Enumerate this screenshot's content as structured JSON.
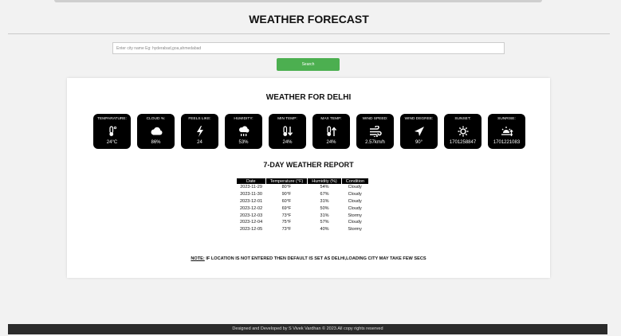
{
  "header": {
    "title": "WEATHER FORECAST"
  },
  "search": {
    "placeholder": "Enter city name Eg: hyderabad,goa,ahmedabad",
    "button_label": "Search"
  },
  "weather": {
    "title": "WEATHER FOR DELHI",
    "metrics": [
      {
        "label": "TEMPARATURE:",
        "icon": "thermometer-icon",
        "value": "24°C"
      },
      {
        "label": "CLOUD %:",
        "icon": "cloud-icon",
        "value": "86%"
      },
      {
        "label": "FEELS LIKE:",
        "icon": "lightning-icon",
        "value": "24"
      },
      {
        "label": "HUMIDITY:",
        "icon": "rain-cloud-icon",
        "value": "53%"
      },
      {
        "label": "MIN TEMP:",
        "icon": "thermometer-down-icon",
        "value": "24%"
      },
      {
        "label": "MAX TEMP:",
        "icon": "thermometer-up-icon",
        "value": "24%"
      },
      {
        "label": "WIND SPEED:",
        "icon": "wind-icon",
        "value": "2.57km/h"
      },
      {
        "label": "WIND DEGREE:",
        "icon": "navigation-arrow-icon",
        "value": "90°"
      },
      {
        "label": "SUNSET:",
        "icon": "sun-gear-icon",
        "value": "1701258847"
      },
      {
        "label": "SUNRISE:",
        "icon": "sunrise-icon",
        "value": "1701221083"
      }
    ]
  },
  "report": {
    "title": "7-DAY WEATHER REPORT",
    "columns": [
      "Date",
      "Temperature (°F)",
      "Humidity (%)",
      "Condition"
    ],
    "rows": [
      [
        "2023-11-29",
        "80°F",
        "54%",
        "Cloudy"
      ],
      [
        "2023-11-30",
        "90°F",
        "67%",
        "Cloudy"
      ],
      [
        "2023-12-01",
        "60°F",
        "31%",
        "Cloudy"
      ],
      [
        "2023-12-02",
        "69°F",
        "50%",
        "Cloudy"
      ],
      [
        "2023-12-03",
        "73°F",
        "31%",
        "Stormy"
      ],
      [
        "2023-12-04",
        "75°F",
        "57%",
        "Cloudy"
      ],
      [
        "2023-12-05",
        "73°F",
        "40%",
        "Stormy"
      ]
    ]
  },
  "note": {
    "prefix": "NOTE:",
    "text": " IF LOCATION IS NOT ENTERED THEN DEFAULT IS SET AS DELHI,LOADING CITY MAY TAKE FEW SECS"
  },
  "footer": {
    "text": "Designed and Developed by S Vivek Vardhan © 2023.All copy rights reserved"
  },
  "colors": {
    "accent": "#4caf50",
    "tile_bg": "#000000",
    "footer_bg": "#2b2b2b"
  }
}
